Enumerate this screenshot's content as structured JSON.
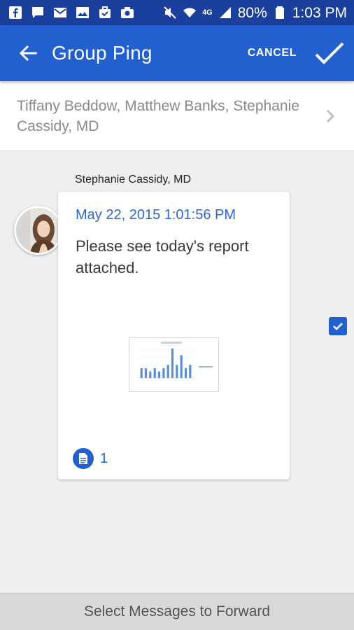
{
  "status_bar": {
    "battery": "80%",
    "time": "1:03 PM",
    "network": "4G",
    "left_icons": [
      "facebook-icon",
      "chat-icon",
      "mail-icon",
      "image-icon",
      "bag-icon",
      "camera-icon"
    ],
    "right_icons": [
      "mute-icon",
      "wifi-icon",
      "signal-icon",
      "battery-icon"
    ]
  },
  "app_bar": {
    "title": "Group Ping",
    "cancel_label": "CANCEL",
    "color": "#2260cf"
  },
  "recipients": {
    "text": "Tiffany Beddow, Matthew Banks, Stephanie Cassidy, MD"
  },
  "message": {
    "sender": "Stephanie Cassidy, MD",
    "timestamp": "May 22, 2015 1:01:56 PM",
    "body": "Please see today's report attached.",
    "attachment_count": "1",
    "selected": true,
    "thumbnail_chart": {
      "type": "bar",
      "values": [
        3,
        3,
        2,
        3,
        2,
        3,
        4,
        9,
        4,
        7,
        3,
        4
      ]
    }
  },
  "bottom_bar": {
    "label": "Select Messages to Forward"
  }
}
